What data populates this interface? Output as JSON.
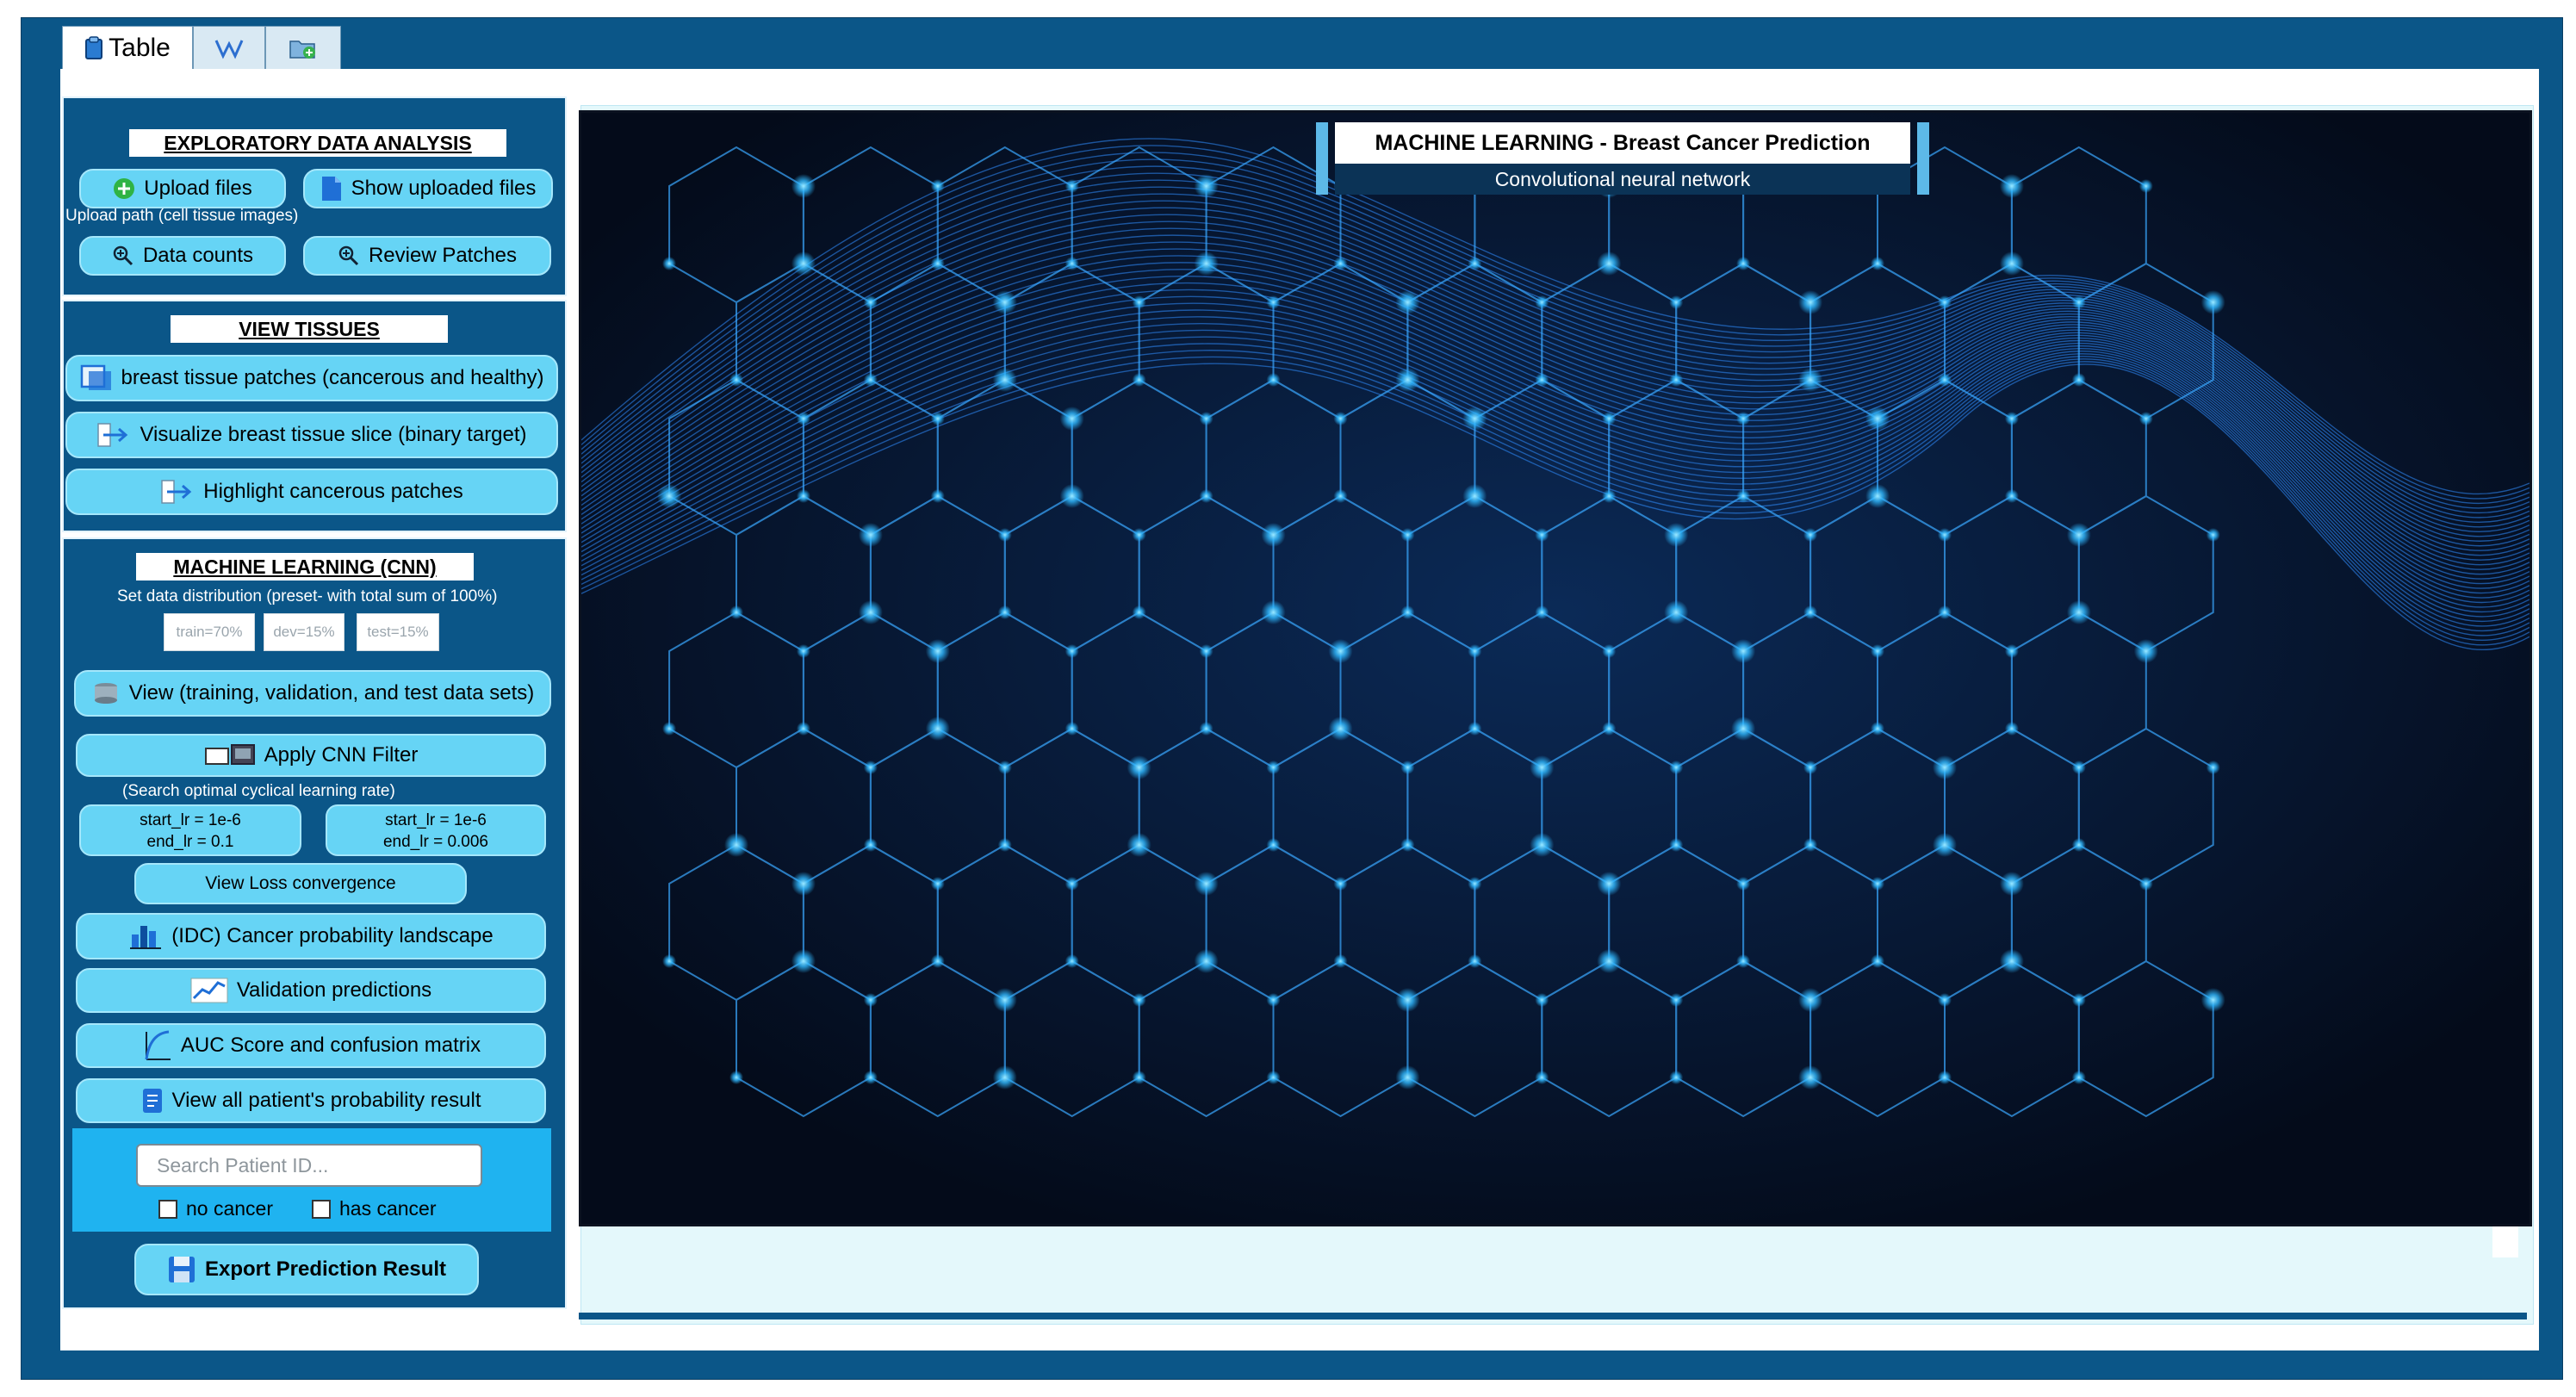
{
  "tabs": [
    {
      "label": "Table",
      "icon": "clipboard-icon",
      "active": true
    },
    {
      "label": "",
      "icon": "w-letter-icon",
      "active": false
    },
    {
      "label": "",
      "icon": "folder-add-icon",
      "active": false
    }
  ],
  "eda": {
    "title": "EXPLORATORY DATA ANALYSIS",
    "upload_label": "Upload files",
    "show_uploaded_label": "Show uploaded files",
    "upload_path_text": "Upload path (cell tissue images)",
    "data_counts_label": "Data counts",
    "review_patches_label": "Review Patches"
  },
  "view_tissues": {
    "title": "VIEW TISSUES",
    "patches_label": "breast tissue patches (cancerous and healthy)",
    "visualize_label": "Visualize  breast tissue slice (binary target)",
    "highlight_label": "Highlight cancerous patches"
  },
  "ml": {
    "title": "MACHINE LEARNING (CNN)",
    "distribution_text": "Set data distribution (preset- with total sum of 100%)",
    "train_chip": "train=70%",
    "dev_chip": "dev=15%",
    "test_chip": "test=15%",
    "view_sets_label": "View (training, validation, and  test data sets)",
    "apply_cnn_label": "Apply CNN Filter",
    "search_lr_text": "(Search optimal cyclical learning rate)",
    "lr1_start": "start_lr = 1e-6",
    "lr1_end": "end_lr = 0.1",
    "lr2_start": "start_lr = 1e-6",
    "lr2_end": "end_lr = 0.006",
    "loss_label": "View Loss convergence",
    "landscape_label": "(IDC) Cancer probability landscape",
    "validation_label": "Validation predictions",
    "auc_label": "AUC Score and confusion matrix",
    "patient_prob_label": "View all patient's probability result",
    "search_placeholder": "Search Patient ID...",
    "no_cancer_label": "no cancer",
    "has_cancer_label": "has cancer",
    "export_label": "Export Prediction Result"
  },
  "hero": {
    "title": "MACHINE LEARNING  - Breast Cancer Prediction",
    "subtitle": "Convolutional neural network"
  },
  "colors": {
    "frame": "#0b5688",
    "button": "#66d4f5",
    "search_panel": "#1fb3f0",
    "hero_bg": "#040b1a",
    "network_glow": "#2fb8ff"
  }
}
